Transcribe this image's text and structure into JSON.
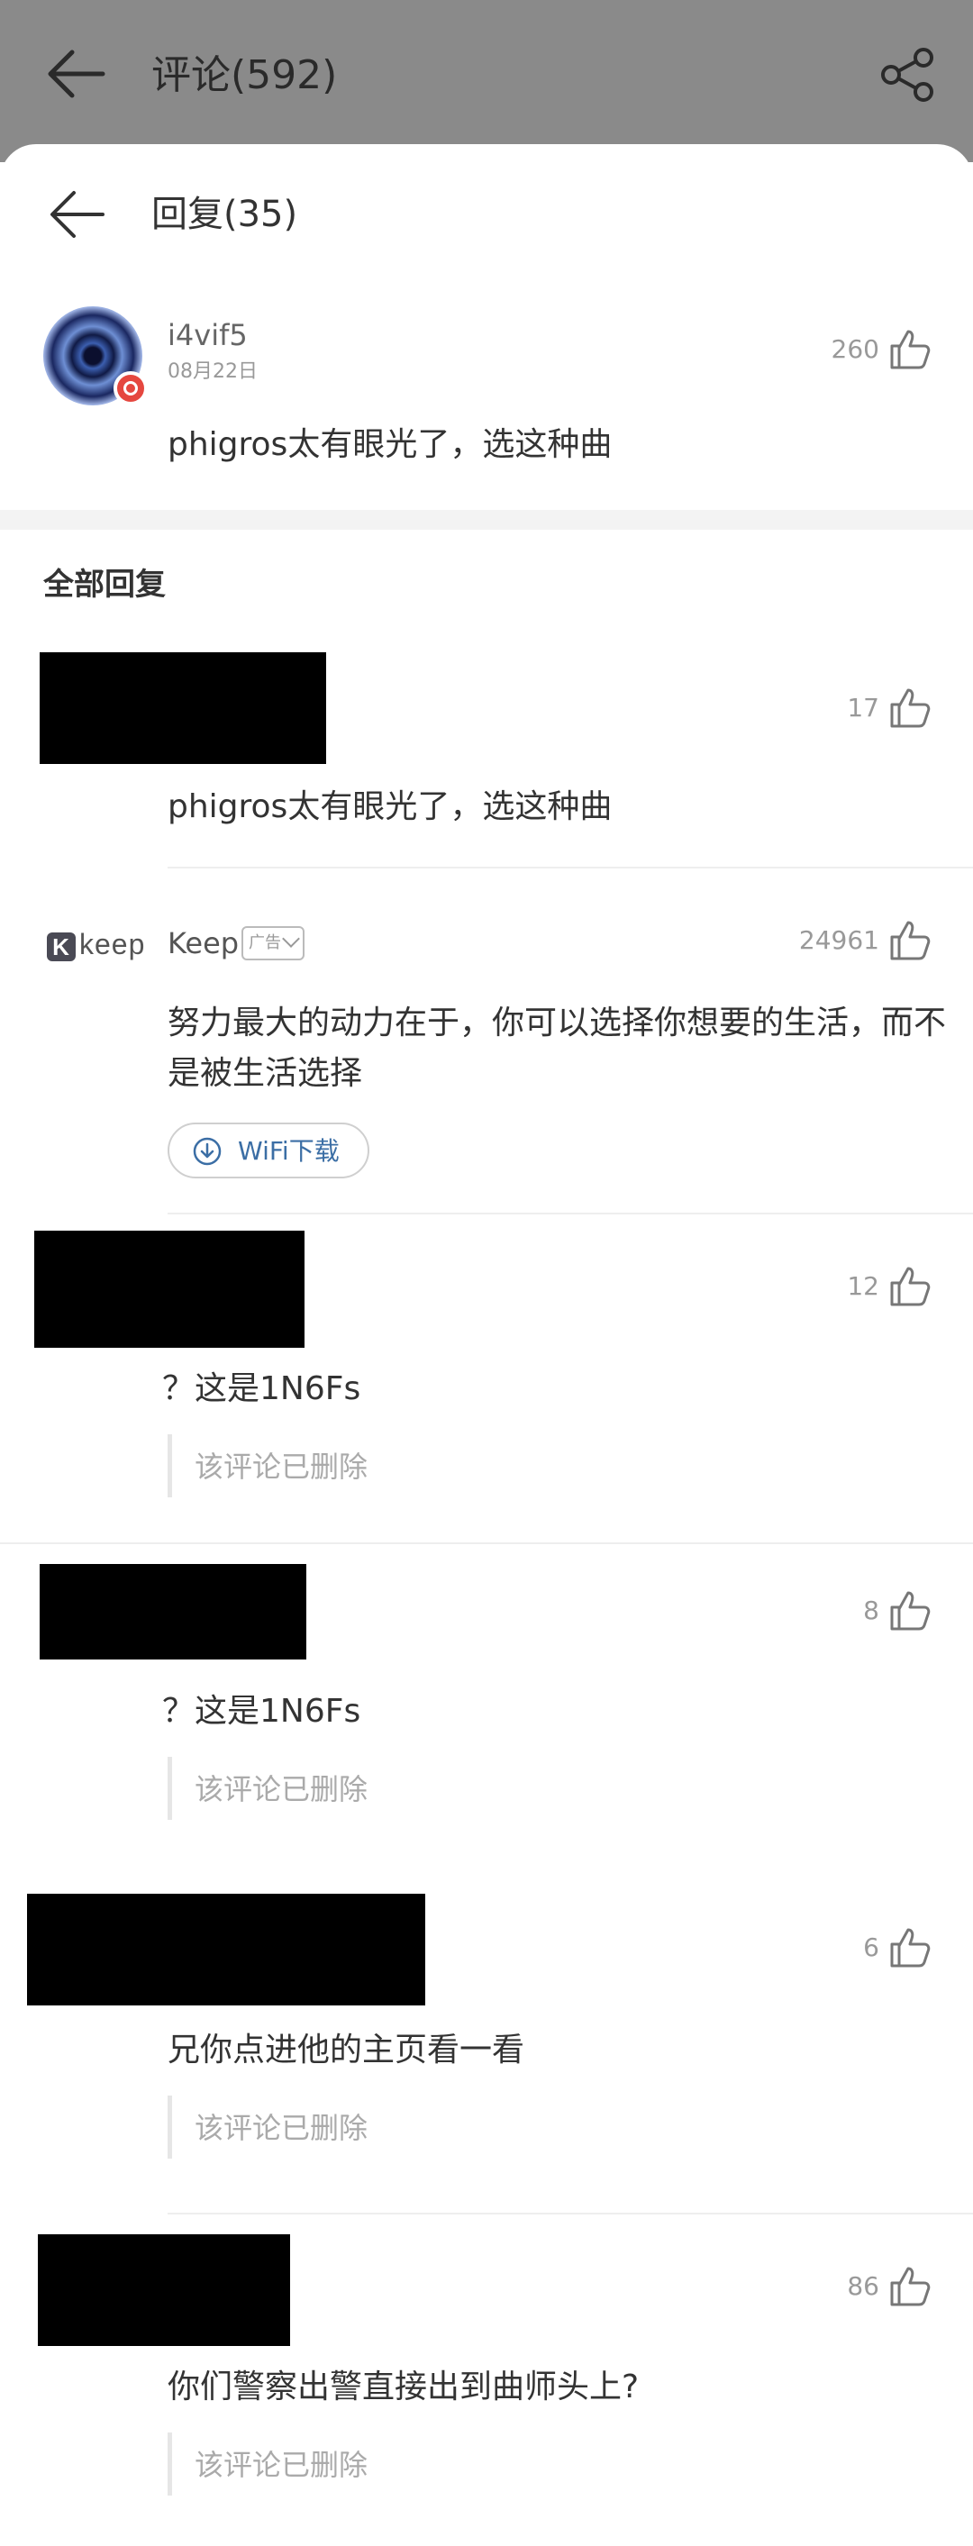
{
  "parent": {
    "title": "评论(592)"
  },
  "sheet": {
    "title": "回复(35)"
  },
  "main_comment": {
    "username": "i4vif5",
    "date": "08月22日",
    "text": "phigros太有眼光了，选这种曲",
    "likes": "260"
  },
  "section_title": "全部回复",
  "replies": [
    {
      "text": "phigros太有眼光了，选这种曲",
      "likes": "17"
    },
    {
      "text": "？这是1N6Fs",
      "likes": "12",
      "quoted": "该评论已删除"
    },
    {
      "text": "？这是1N6Fs",
      "likes": "8",
      "quoted": "该评论已删除"
    },
    {
      "text": "兄你点进他的主页看一看",
      "likes": "6",
      "quoted": "该评论已删除"
    },
    {
      "text": "你们警察出警直接出到曲师头上?",
      "likes": "86",
      "quoted": "该评论已删除"
    }
  ],
  "ad": {
    "logo_text": "keep",
    "logo_letter": "K",
    "name": "Keep",
    "tag": "广告",
    "likes": "24961",
    "line1": "努力最大的动力在于，你可以选择你想要的生活，而不",
    "line2": "是被生活选择",
    "button": "WiFi下载"
  },
  "icons": [
    "back-arrow-icon",
    "share-icon",
    "thumbs-up-icon",
    "download-icon",
    "chevron-down-icon"
  ]
}
